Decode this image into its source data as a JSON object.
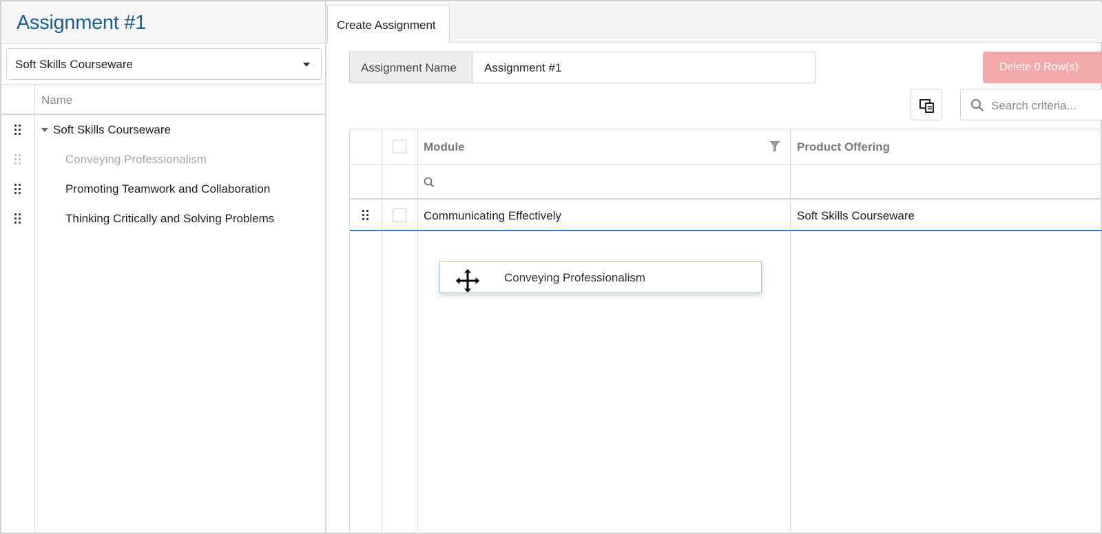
{
  "left_panel": {
    "title": "Assignment #1",
    "dropdown_value": "Soft Skills Courseware",
    "tree_header": "Name",
    "tree": [
      {
        "label": "Soft Skills Courseware",
        "expanded": true,
        "level": 0
      },
      {
        "label": "Conveying Professionalism",
        "level": 1,
        "dragging": true
      },
      {
        "label": "Promoting Teamwork and Collaboration",
        "level": 1
      },
      {
        "label": "Thinking Critically and Solving Problems",
        "level": 1
      }
    ]
  },
  "tabs": [
    {
      "label": "Create Assignment",
      "active": true
    }
  ],
  "form": {
    "assignment_name_label": "Assignment Name",
    "assignment_name_value": "Assignment #1"
  },
  "toolbar": {
    "delete_label": "Delete 0 Row(s)",
    "search_placeholder": "Search criteria..."
  },
  "grid": {
    "columns": [
      "Module",
      "Product Offering"
    ],
    "rows": [
      {
        "module": "Communicating Effectively",
        "product_offering": "Soft Skills Courseware"
      }
    ]
  },
  "drag_ghost": {
    "label": "Conveying Professionalism"
  },
  "colors": {
    "title": "#1b5f8c",
    "delete_disabled": "#f1a9a9",
    "drop_indicator": "#2f79c6"
  }
}
